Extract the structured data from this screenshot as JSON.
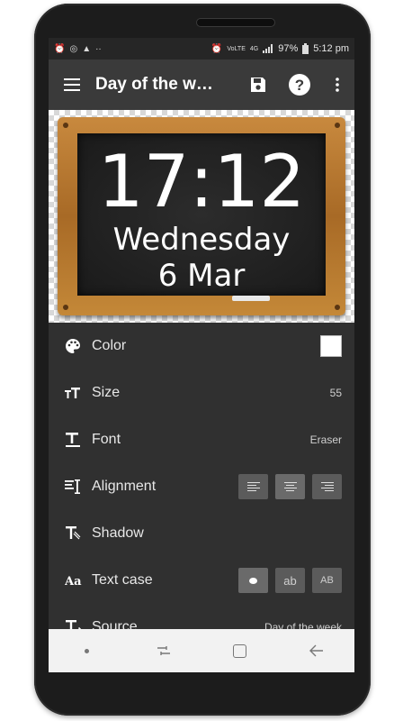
{
  "status_bar": {
    "left_icons": [
      "alarm-icon",
      "sync-icon",
      "warning-icon",
      "dots-icon"
    ],
    "volte_label": "VoLTE",
    "network_label": "4G",
    "battery_percent": "97%",
    "time": "5:12 pm"
  },
  "toolbar": {
    "title": "Day of the week",
    "icons": [
      "menu-icon",
      "save-icon",
      "help-icon",
      "more-vert-icon"
    ]
  },
  "preview": {
    "time": "17:12",
    "day": "Wednesday",
    "date": "6 Mar"
  },
  "settings": {
    "color": {
      "label": "Color",
      "value_color": "#ffffff"
    },
    "size": {
      "label": "Size",
      "value": "55"
    },
    "font": {
      "label": "Font",
      "value": "Eraser"
    },
    "alignment": {
      "label": "Alignment",
      "selected": "center"
    },
    "shadow": {
      "label": "Shadow"
    },
    "text_case": {
      "label": "Text case",
      "option_lower": "ab",
      "option_upper": "AB"
    },
    "source": {
      "label": "Source",
      "value": "Day of the week"
    }
  },
  "colors": {
    "toolbar_bg": "#3a3a3a",
    "list_bg": "#303030",
    "frame_wood": "#b87a32",
    "board": "#1f1f1f"
  }
}
